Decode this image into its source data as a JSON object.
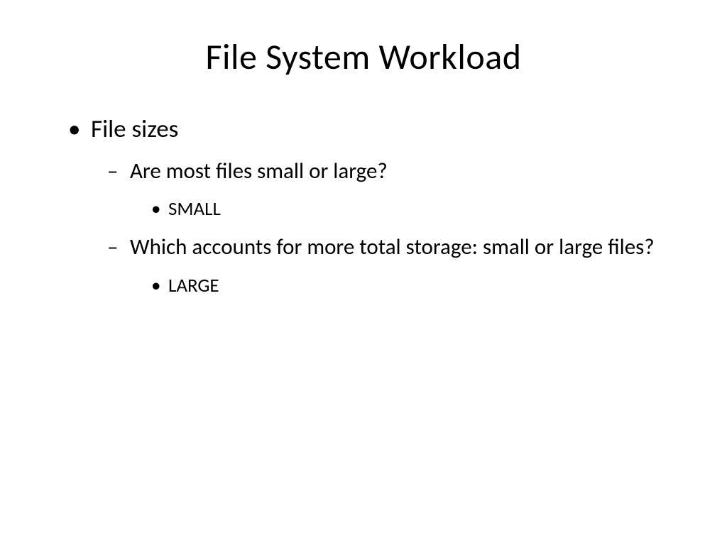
{
  "slide": {
    "title": "File System Workload",
    "bullets": {
      "l1_item1": "File sizes",
      "l2_item1": "Are most files small or large?",
      "l3_item1": "SMALL",
      "l2_item2": "Which accounts for more total storage: small or large files?",
      "l3_item2": "LARGE"
    }
  }
}
